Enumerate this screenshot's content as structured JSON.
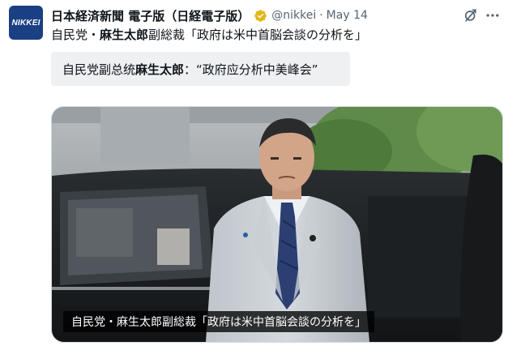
{
  "tweet": {
    "avatar_text": "NIKKEI",
    "display_name": "日本経済新聞 電子版（日経電子版）",
    "handle": "@nikkei",
    "separator": "·",
    "timestamp": "May 14",
    "text_prefix": "自民党・",
    "text_bold": "麻生太郎",
    "text_suffix": "副総裁「政府は米中首脳会談の分析を」",
    "translation_prefix": "自民党副总统",
    "translation_bold": "麻生太郎",
    "translation_suffix": "：“政府应分析中美峰会”",
    "image_caption": "自民党・麻生太郎副総裁「政府は米中首脳会談の分析を」"
  },
  "icons": {
    "verified": "verified-gold-check-icon",
    "grok": "grok-icon",
    "more": "more-horizontal-icon"
  },
  "colors": {
    "verified_gold": "#e2b719",
    "handle_grey": "#536471",
    "nikkei_blue": "#1a3f82",
    "translation_bg": "#eef0f2"
  }
}
